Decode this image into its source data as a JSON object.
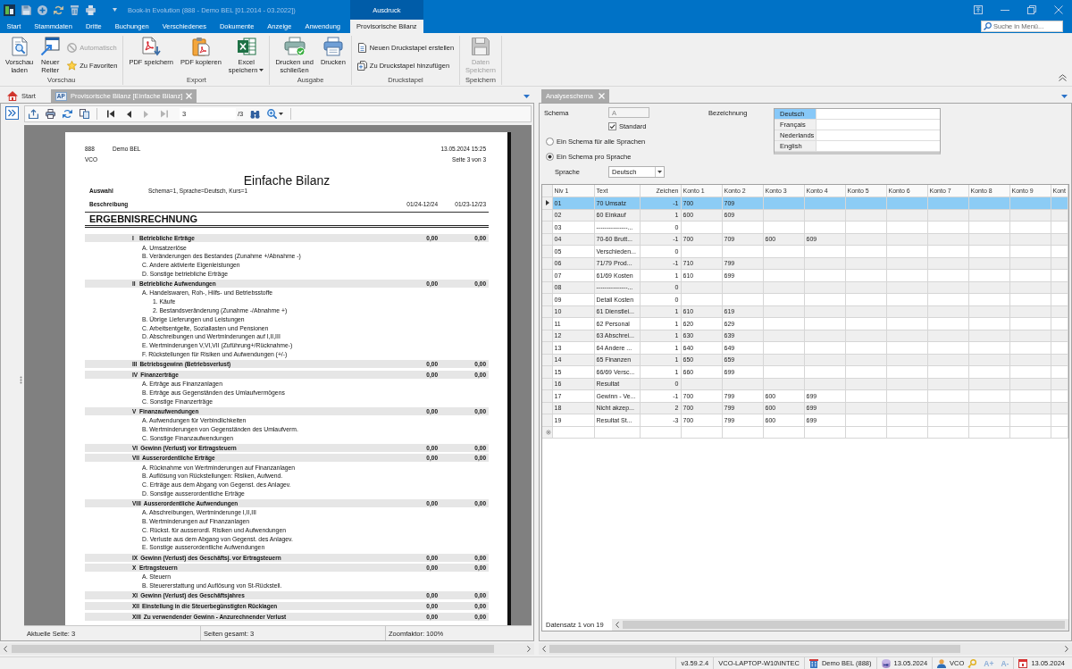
{
  "window": {
    "title": "Book-in Evolution (888 - Demo BEL [01.2014 - 03.2022])",
    "context_group": "Ausdruck"
  },
  "ribbon_tabs": [
    {
      "label": "Start",
      "kind": "tab",
      "selected": false
    },
    {
      "label": "Stammdaten",
      "kind": "tab",
      "selected": false
    },
    {
      "label": "Dritte",
      "kind": "tab",
      "selected": false
    },
    {
      "label": "Buchungen",
      "kind": "tab",
      "selected": false
    },
    {
      "label": "Verschiedenes",
      "kind": "tab",
      "selected": false
    },
    {
      "label": "Dokumente",
      "kind": "tab",
      "selected": false
    },
    {
      "label": "Anzeige",
      "kind": "tab",
      "selected": false
    },
    {
      "label": "Anwendung",
      "kind": "tab",
      "selected": false
    },
    {
      "label": "Provisorische Bilanz",
      "kind": "context",
      "selected": true
    }
  ],
  "menu_search": {
    "placeholder": "Suche in Menü..."
  },
  "ribbon_groups": [
    {
      "label": "Vorschau",
      "buttons": [
        {
          "kind": "large",
          "label": "Vorschau\nladen",
          "disabled": false
        },
        {
          "kind": "large",
          "label": "Neuer\nReiter",
          "disabled": false
        },
        {
          "kind": "small",
          "label": "Automatisch",
          "disabled": true
        },
        {
          "kind": "small",
          "label": "Zu Favoriten",
          "disabled": false
        }
      ]
    },
    {
      "label": "Export",
      "buttons": [
        {
          "kind": "large",
          "label": "PDF speichern",
          "disabled": false
        },
        {
          "kind": "large",
          "label": "PDF kopieren",
          "disabled": false
        },
        {
          "kind": "menu",
          "label": "Excel\nspeichern",
          "disabled": false
        }
      ]
    },
    {
      "label": "Ausgabe",
      "buttons": [
        {
          "kind": "large",
          "label": "Drucken und\nschließen",
          "disabled": false
        },
        {
          "kind": "large",
          "label": "Drucken",
          "disabled": false
        }
      ]
    },
    {
      "label": "Druckstapel",
      "buttons": [
        {
          "kind": "small",
          "label": "Neuen Druckstapel erstellen",
          "disabled": false
        },
        {
          "kind": "small",
          "label": "Zu Druckstapel hinzufügen",
          "disabled": false
        }
      ]
    },
    {
      "label": "Speichern",
      "buttons": [
        {
          "kind": "large",
          "label": "Daten\nSpeichern",
          "disabled": true
        }
      ]
    }
  ],
  "document_tabs": [
    {
      "kind": "home",
      "label": "Start",
      "selected": false
    },
    {
      "kind": "report",
      "badge": "AP",
      "label": "Provisorische Bilanz [Einfache Bilanz]",
      "selected": true
    }
  ],
  "viewer": {
    "navigation": [
      {
        "kind": "first",
        "disabled": false
      },
      {
        "kind": "previous",
        "disabled": false
      },
      {
        "kind": "next",
        "disabled": true
      },
      {
        "kind": "last",
        "disabled": true
      }
    ],
    "page_field": {
      "value": "3"
    },
    "page_count": "/3",
    "status": [
      "Aktuelle Seite: 3",
      "Seiten gesamt: 3",
      "Zoomfaktor: 100%"
    ]
  },
  "report": {
    "company_number": "888",
    "company": "Demo BEL",
    "user": "VCO",
    "printed_at": "13.05.2024 15:25",
    "page": "Seite 3 von 3",
    "title": "Einfache Bilanz",
    "selection_label": "Auswahl",
    "selection": "Schema=1, Sprache=Deutsch, Kurs=1",
    "description_label": "Beschreibung",
    "periods": [
      "01/24-12/24",
      "01/23-12/23"
    ],
    "section": "ERGEBNISRECHNUNG",
    "lines": [
      {
        "number": "I",
        "title": "Betriebliche Erträge",
        "values": [
          "0,00",
          "0,00"
        ],
        "children": [
          {
            "text": "A. Umsatzerlöse"
          },
          {
            "text": "B. Veränderungen des Bestandes (Zunahme +/Abnahme -)"
          },
          {
            "text": "C. Andere aktivierte Eigenleistungen"
          },
          {
            "text": "D. Sonstige betriebliche Erträge"
          }
        ]
      },
      {
        "number": "II",
        "title": "Betriebliche Aufwendungen",
        "values": [
          "0,00",
          "0,00"
        ],
        "children": [
          {
            "text": "A. Handelswaren, Roh-, Hilfs- und Betriebsstoffe",
            "children": [
              {
                "text": "1. Käufe"
              },
              {
                "text": "2. Bestandsveränderung (Zunahme -/Abnahme +)"
              }
            ]
          },
          {
            "text": "B. Übrige Lieferungen und Leistungen"
          },
          {
            "text": "C. Arbeitsentgelte, Soziallasten und Pensionen"
          },
          {
            "text": "D. Abschreibungen und Wertminderungen auf I,II,III"
          },
          {
            "text": "E. Wertminderungen V,VI,VII (Zuführung+/Rücknahme-)"
          },
          {
            "text": "F. Rückstellungen für Risiken und Aufwendungen (+/-)"
          }
        ]
      },
      {
        "number": "III",
        "title": "Betriebsgewinn (Betriebsverlust)",
        "values": [
          "0,00",
          "0,00"
        ]
      },
      {
        "number": "IV",
        "title": "Finanzerträge",
        "values": [
          "0,00",
          "0,00"
        ],
        "children": [
          {
            "text": "A. Erträge aus Finanzanlagen"
          },
          {
            "text": "B. Erträge aus Gegenständen des Umlaufvermögens"
          },
          {
            "text": "C. Sonstige Finanzerträge"
          }
        ]
      },
      {
        "number": "V",
        "title": "Finanzaufwendungen",
        "values": [
          "0,00",
          "0,00"
        ],
        "children": [
          {
            "text": "A. Aufwendungen für Verbindlichkeiten"
          },
          {
            "text": "B. Wertminderungen von Gegenständen des Umlaufverm."
          },
          {
            "text": "C. Sonstige Finanzaufwendungen"
          }
        ]
      },
      {
        "number": "VI",
        "title": "Gewinn (Verlust) vor Ertragsteuern",
        "values": [
          "0,00",
          "0,00"
        ]
      },
      {
        "number": "VII",
        "title": "Ausserordentliche Erträge",
        "values": [
          "0,00",
          "0,00"
        ],
        "children": [
          {
            "text": "A. Rücknahme von Wertminderungen auf Finanzanlagen"
          },
          {
            "text": "B. Auflösung von Rückstellungen: Risiken, Aufwend."
          },
          {
            "text": "C. Erträge aus dem Abgang von Gegenst. des Anlagev."
          },
          {
            "text": "D. Sonstige ausserordentliche Erträge"
          }
        ]
      },
      {
        "number": "VIII",
        "title": "Ausserordentliche Aufwendungen",
        "values": [
          "0,00",
          "0,00"
        ],
        "children": [
          {
            "text": "A. Abschreibungen, Wertminderunge I,II,III"
          },
          {
            "text": "B. Wertminderungen auf Finanzanlagen"
          },
          {
            "text": "C. Rückst. für ausserordl. Risiken und Aufwendungen"
          },
          {
            "text": "D. Verluste aus dem Abgang von Gegenst. des Anlagev."
          },
          {
            "text": "E. Sonstige ausserordentliche Aufwendungen"
          }
        ]
      },
      {
        "number": "IX",
        "title": "Gewinn (Verlust) des Geschäftsj. vor Ertragsteuern",
        "values": [
          "0,00",
          "0,00"
        ]
      },
      {
        "number": "X",
        "title": "Ertragsteuern",
        "values": [
          "0,00",
          "0,00"
        ],
        "children": [
          {
            "text": "A. Steuern"
          },
          {
            "text": "B. Steuererstattung und Auflösung von St-Rückstell."
          }
        ]
      },
      {
        "number": "XI",
        "title": "Gewinn (Verlust) des Geschäftsjahres",
        "values": [
          "0,00",
          "0,00"
        ]
      },
      {
        "number": "XII",
        "title": "Einstellung in die Steuerbegünstigten Rücklagen",
        "values": [
          "0,00",
          "0,00"
        ]
      },
      {
        "number": "XIII",
        "title": "Zu verwendender Gewinn - Anzurechnender Verlust",
        "values": [
          "0,00",
          "0,00"
        ]
      }
    ]
  },
  "analysis": {
    "tabs": [
      {
        "label": "Analyseschema",
        "selected": true
      }
    ],
    "schema": {
      "label": "Schema",
      "value": "A",
      "disabled": true
    },
    "standard": {
      "label": "Standard",
      "checked": true
    },
    "designation": {
      "label": "Bezeichnung",
      "languages": [
        {
          "language": "Deutsch",
          "selected": true
        },
        {
          "language": "Français",
          "selected": false
        },
        {
          "language": "Nederlands",
          "selected": false
        },
        {
          "language": "English",
          "selected": false
        }
      ]
    },
    "modes": [
      {
        "label": "Ein Schema für alle Sprachen",
        "selected": false
      },
      {
        "label": "Ein Schema pro Sprache",
        "selected": true
      }
    ],
    "language": {
      "label": "Sprache",
      "value": "Deutsch"
    },
    "grid": {
      "columns": [
        "Niv 1",
        "Text",
        "Zeichen",
        "Konto 1",
        "Konto 2",
        "Konto 3",
        "Konto 4",
        "Konto 5",
        "Konto 6",
        "Konto 7",
        "Konto 8",
        "Konto 9",
        "Kont"
      ],
      "rows": [
        {
          "selected": true,
          "cells": [
            "01",
            "70 Umsatz",
            "-1",
            "700",
            "709"
          ]
        },
        {
          "selected": false,
          "cells": [
            "02",
            "60 Einkauf",
            "1",
            "600",
            "609"
          ]
        },
        {
          "selected": false,
          "cells": [
            "03",
            "---------------...",
            "0"
          ]
        },
        {
          "selected": false,
          "cells": [
            "04",
            "70-60 Brutt...",
            "-1",
            "700",
            "709",
            "600",
            "609"
          ]
        },
        {
          "selected": false,
          "cells": [
            "05",
            "Verschieden...",
            "0"
          ]
        },
        {
          "selected": false,
          "cells": [
            "06",
            "71/79 Prod...",
            "-1",
            "710",
            "799"
          ]
        },
        {
          "selected": false,
          "cells": [
            "07",
            "61/69 Kosten",
            "1",
            "610",
            "699"
          ]
        },
        {
          "selected": false,
          "cells": [
            "08",
            "---------------...",
            "0"
          ]
        },
        {
          "selected": false,
          "cells": [
            "09",
            "Detail Kosten",
            "0"
          ]
        },
        {
          "selected": false,
          "cells": [
            "10",
            "61 Dienstlei...",
            "1",
            "610",
            "619"
          ]
        },
        {
          "selected": false,
          "cells": [
            "11",
            "62 Personal",
            "1",
            "620",
            "629"
          ]
        },
        {
          "selected": false,
          "cells": [
            "12",
            "63 Abschrei...",
            "1",
            "630",
            "639"
          ]
        },
        {
          "selected": false,
          "cells": [
            "13",
            "64 Andere ...",
            "1",
            "640",
            "649"
          ]
        },
        {
          "selected": false,
          "cells": [
            "14",
            "65 Finanzen",
            "1",
            "650",
            "659"
          ]
        },
        {
          "selected": false,
          "cells": [
            "15",
            "66/69 Versc...",
            "1",
            "660",
            "699"
          ]
        },
        {
          "selected": false,
          "cells": [
            "16",
            "Resultat",
            "0"
          ]
        },
        {
          "selected": false,
          "cells": [
            "17",
            "Gewinn - Ve...",
            "-1",
            "700",
            "799",
            "600",
            "699"
          ]
        },
        {
          "selected": false,
          "cells": [
            "18",
            "Nicht akzep...",
            "2",
            "700",
            "799",
            "600",
            "699"
          ]
        },
        {
          "selected": false,
          "cells": [
            "19",
            "Resultat St...",
            "-3",
            "700",
            "799",
            "600",
            "699"
          ]
        }
      ]
    },
    "record_info": "Datensatz 1 von 19"
  },
  "status_bar": {
    "version": "v3.59.2.4",
    "machine": "VCO-LAPTOP-W10\\INTEC",
    "company": "Demo BEL (888)",
    "database_date": "13.05.2024",
    "user": "VCO",
    "font_sizes": [
      "A+",
      "A-"
    ],
    "date": "13.05.2024"
  }
}
